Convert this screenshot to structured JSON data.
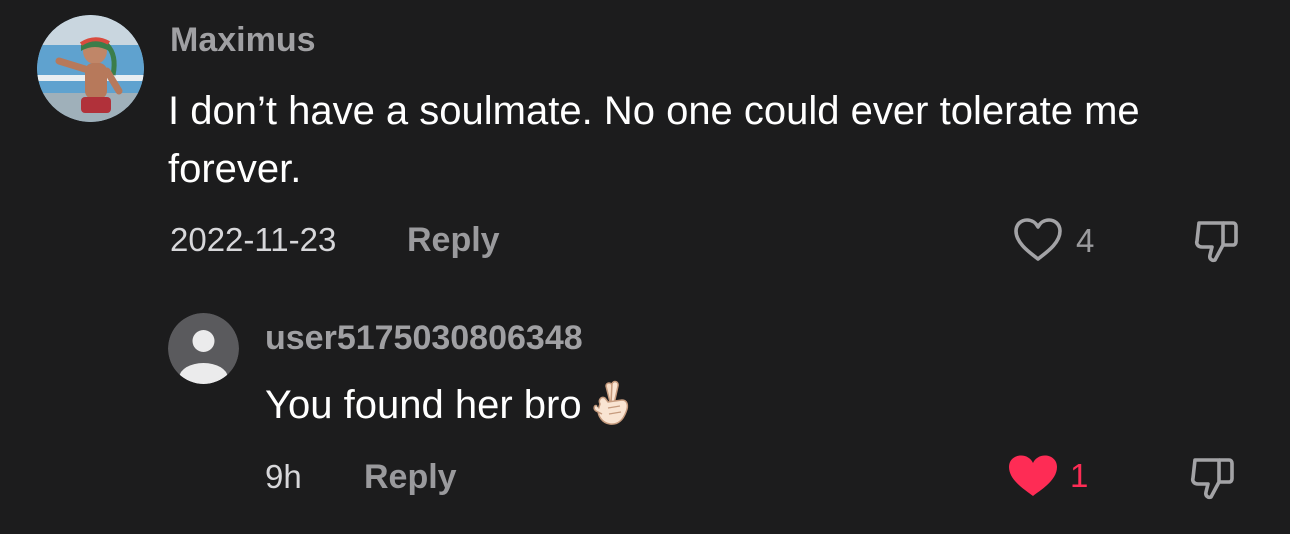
{
  "comment": {
    "username": "Maximus",
    "text": "I don’t have a soulmate. No one could ever tolerate me forever.",
    "date": "2022-11-23",
    "reply_label": "Reply",
    "like_count": "4",
    "liked": false,
    "icons": {
      "avatar": "profile-photo",
      "like": "heart-outline-icon",
      "dislike": "thumbs-down-icon"
    }
  },
  "reply": {
    "username": "user5175030806348",
    "text": "You found her bro",
    "emoji": "crossed-fingers-emoji",
    "time": "9h",
    "reply_label": "Reply",
    "like_count": "1",
    "liked": true,
    "icons": {
      "avatar": "default-avatar-icon",
      "like": "heart-filled-icon",
      "dislike": "thumbs-down-icon"
    }
  },
  "colors": {
    "background": "#1c1c1d",
    "liked": "#fe2c55",
    "muted": "#9a9a9d"
  }
}
